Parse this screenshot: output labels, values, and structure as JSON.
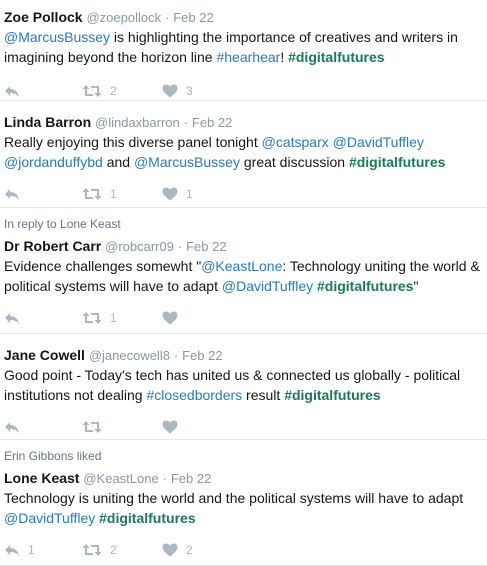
{
  "colors": {
    "link": "#2b7bb9",
    "hashtag_strong": "#1a7a59",
    "icon": "#aab8c2",
    "meta": "#8899a6"
  },
  "tweets": [
    {
      "context": "",
      "name": "Zoe Pollock",
      "handle": "@zoepollock",
      "date": "Feb 22",
      "line1": {
        "p1": "@MarcusBussey",
        "p2": " is highlighting the importance of creatives and writers in"
      },
      "line2": {
        "p1": "imagining beyond the horizon line ",
        "p2": "#hearhear",
        "p3": "! ",
        "p4": "#digitalfutures"
      },
      "reply_count": "",
      "retweet_count": "2",
      "like_count": "3"
    },
    {
      "context": "",
      "name": "Linda Barron",
      "handle": "@lindaxbarron",
      "date": "Feb 22",
      "line1": {
        "p1": "Really enjoying this diverse panel tonight ",
        "p2": "@catsparx",
        "p3": " ",
        "p4": "@DavidTuffley"
      },
      "line2": {
        "p1": "@jordanduffybd",
        "p2": " and ",
        "p3": "@MarcusBussey",
        "p4": " great discussion ",
        "p5": "#digitalfutures"
      },
      "reply_count": "",
      "retweet_count": "1",
      "like_count": "1"
    },
    {
      "context": "In reply to Lone Keast",
      "name": "Dr Robert Carr",
      "handle": "@robcarr09",
      "date": "Feb 22",
      "line1": {
        "p1": "Evidence challenges somewht  \"",
        "p2": "@KeastLone",
        "p3": ": Technology uniting the world &"
      },
      "line2": {
        "p1": "political systems will have to adapt ",
        "p2": "@DavidTuffley",
        "p3": " ",
        "p4": "#digitalfutures",
        "p5": "\""
      },
      "reply_count": "",
      "retweet_count": "1",
      "like_count": ""
    },
    {
      "context": "",
      "name": "Jane Cowell",
      "handle": "@janecowell8",
      "date": "Feb 22",
      "line1": {
        "p1": "Good point - Today's tech has united us & connected us globally - political"
      },
      "line2": {
        "p1": "institutions not dealing ",
        "p2": "#closedborders",
        "p3": " result ",
        "p4": "#digitalfutures"
      },
      "reply_count": "",
      "retweet_count": "",
      "like_count": ""
    },
    {
      "context": "Erin Gibbons liked",
      "name": "Lone Keast",
      "handle": "@KeastLone",
      "date": "Feb 22",
      "line1": {
        "p1": "Technology is uniting the world and the political systems will have to adapt"
      },
      "line2": {
        "p1": "@DavidTuffley",
        "p2": " ",
        "p3": "#digitalfutures"
      },
      "reply_count": "1",
      "retweet_count": "2",
      "like_count": "2"
    }
  ]
}
